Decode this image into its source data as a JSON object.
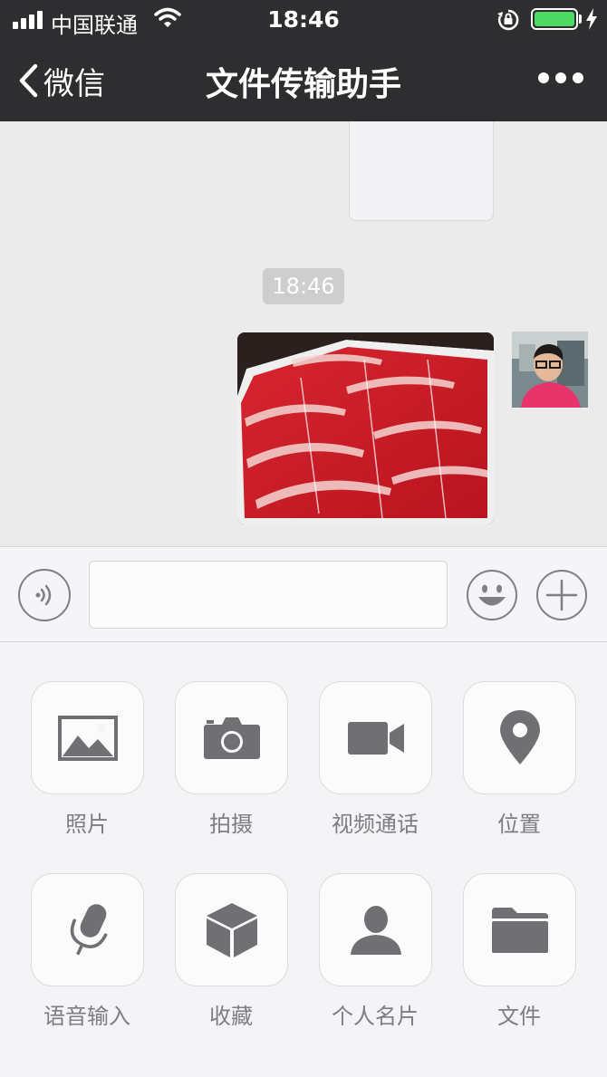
{
  "status_bar": {
    "carrier": "中国联通",
    "time": "18:46",
    "signal_bars": 4,
    "battery_level": 1.0,
    "charging": true
  },
  "nav": {
    "back_label": "微信",
    "title": "文件传输助手",
    "more_icon": "more-dots-icon"
  },
  "chat": {
    "timestamp": "18:46",
    "messages": [
      {
        "type": "image",
        "from": "self",
        "content": "sliced raw beef rolls on a tray"
      }
    ]
  },
  "input": {
    "value": "",
    "placeholder": ""
  },
  "panel": {
    "items": [
      {
        "label": "照片",
        "icon": "photo-icon"
      },
      {
        "label": "拍摄",
        "icon": "camera-icon"
      },
      {
        "label": "视频通话",
        "icon": "video-call-icon"
      },
      {
        "label": "位置",
        "icon": "location-icon"
      },
      {
        "label": "语音输入",
        "icon": "microphone-icon"
      },
      {
        "label": "收藏",
        "icon": "favorites-box-icon"
      },
      {
        "label": "个人名片",
        "icon": "contact-card-icon"
      },
      {
        "label": "文件",
        "icon": "folder-icon"
      }
    ]
  },
  "colors": {
    "nav_background": "#2e2e31",
    "chat_background": "#ebebeb",
    "panel_background": "#f4f4f6",
    "icon_gray": "#6f6f74",
    "battery_green": "#4cd964"
  }
}
